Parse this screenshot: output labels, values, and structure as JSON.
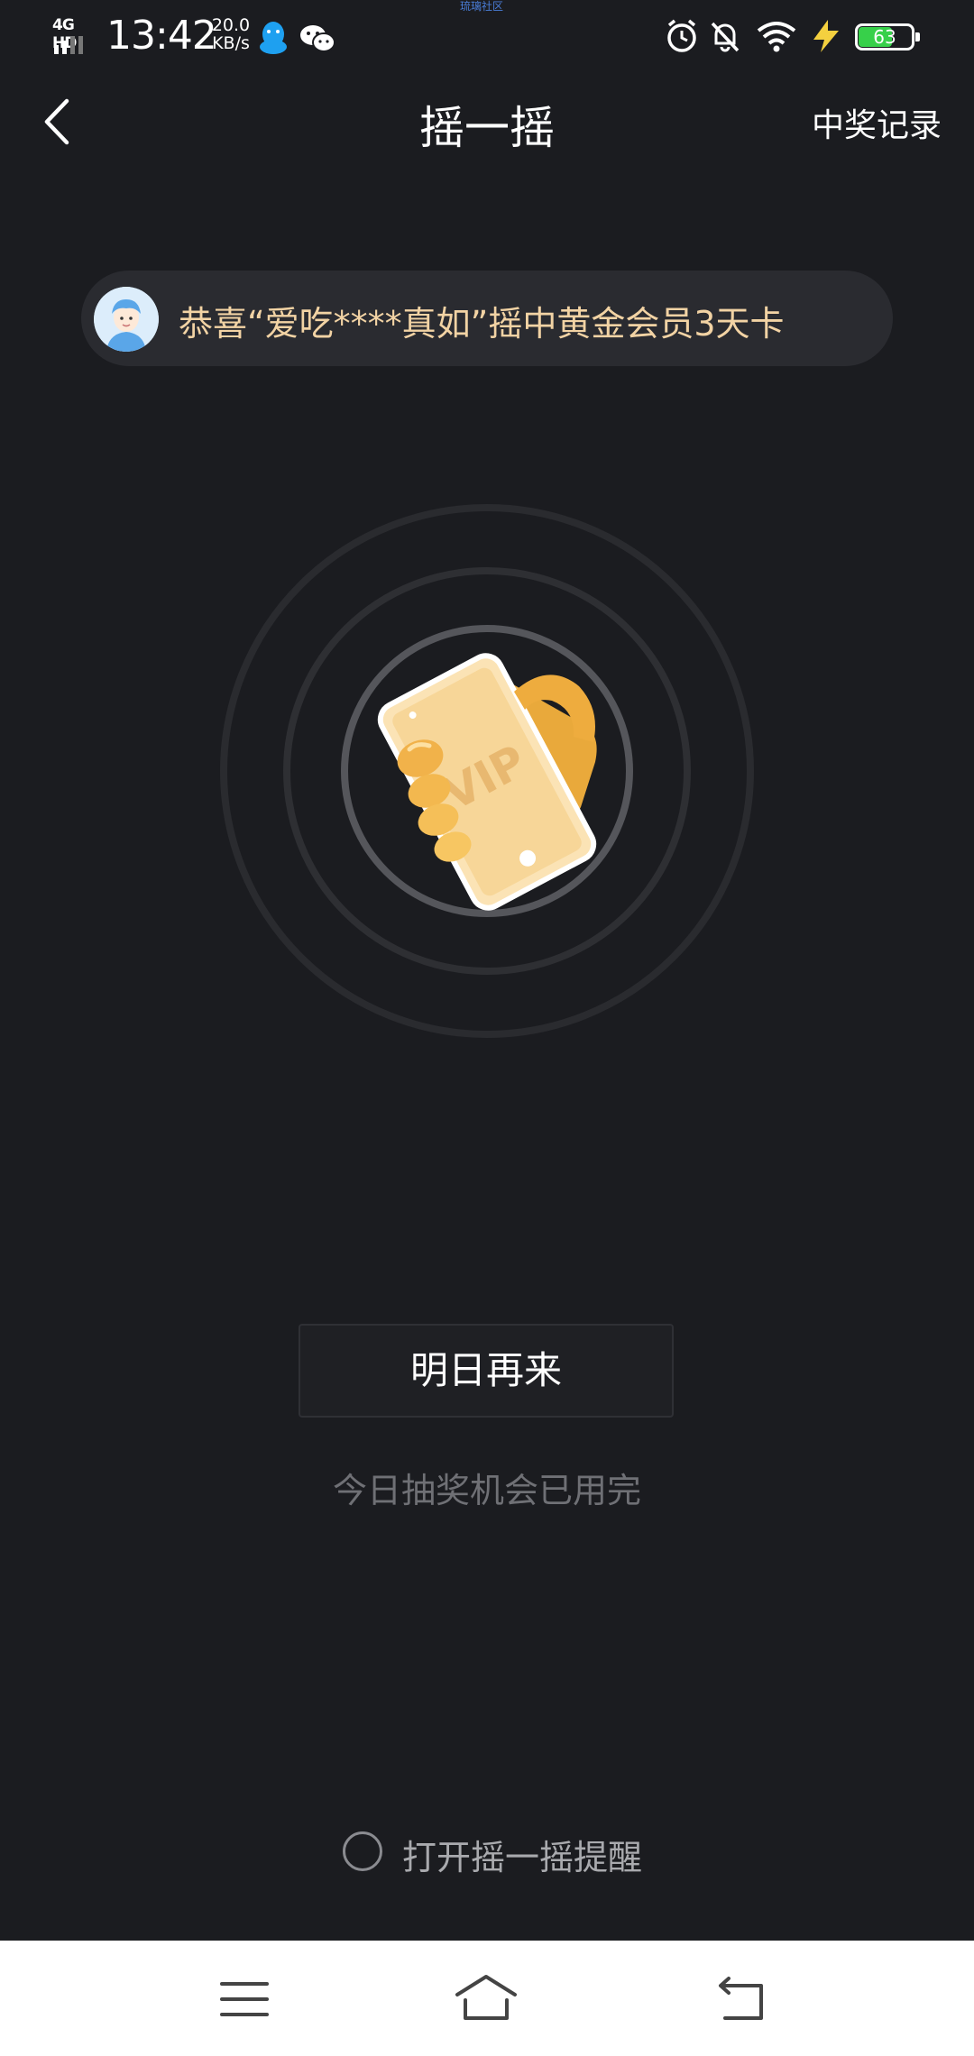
{
  "status_bar": {
    "network": "4G HD",
    "time": "13:42",
    "speed_value": "20.0",
    "speed_unit": "KB/s",
    "watermark": "琉璃社区",
    "battery": "63",
    "battery_color": "#37d04a"
  },
  "nav": {
    "title": "摇一摇",
    "right_link": "中奖记录"
  },
  "ticker": {
    "message": "恭喜“爱吃****真如”摇中黄金会员3天卡"
  },
  "illustration": {
    "card_text": "VIP",
    "accent": "#e9a93b"
  },
  "actions": {
    "primary_button": "明日再来",
    "hint": "今日抽奖机会已用完",
    "reminder_label": "打开摇一摇提醒"
  },
  "colors": {
    "background": "#1b1c20",
    "ticker_text": "#f2d3a4",
    "hint_text": "#6f7075"
  }
}
